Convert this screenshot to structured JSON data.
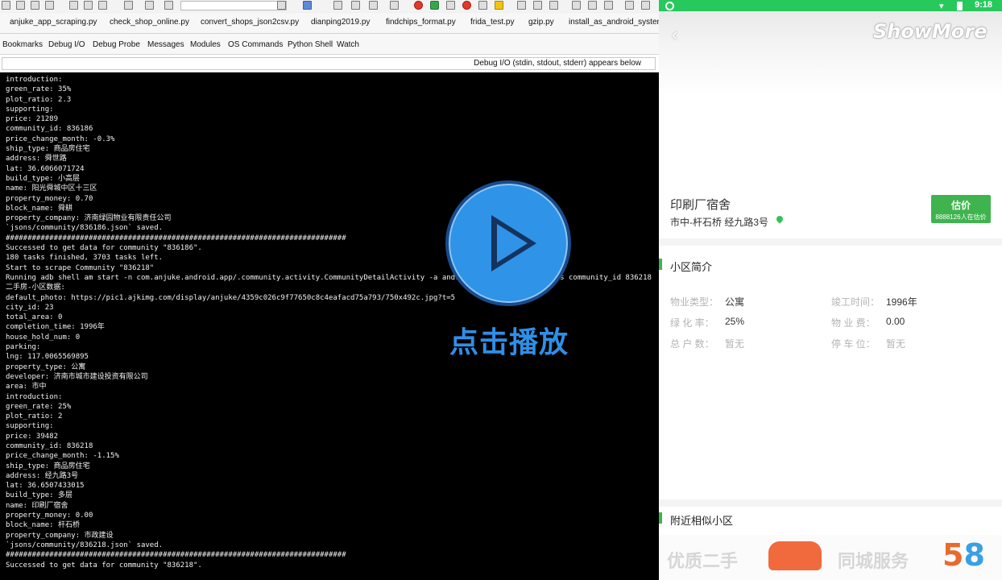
{
  "file_tabs": [
    "anjuke_app_scraping.py",
    "check_shop_online.py",
    "convert_shops_json2csv.py",
    "dianping2019.py",
    "findchips_format.py",
    "frida_test.py",
    "gzip.py",
    "install_as_android_system"
  ],
  "tool_tabs": [
    "Bookmarks",
    "Debug I/O",
    "Debug Probe",
    "Messages",
    "Modules",
    "OS Commands",
    "Python Shell",
    "Watch"
  ],
  "debug_io": {
    "status": "Debug I/O (stdin, stdout, stderr) appears below"
  },
  "console": {
    "lines": [
      "introduction:",
      "green_rate: 35%",
      "plot_ratio: 2.3",
      "supporting:",
      "price: 21289",
      "community_id: 836186",
      "price_change_month: -0.3%",
      "ship_type: 商品房住宅",
      "address: 舜世路",
      "lat: 36.6066071724",
      "build_type: 小高层",
      "name: 阳光舜城中区十三区",
      "property_money: 0.70",
      "block_name: 舜耕",
      "property_company: 济南绿园物业有限责任公司",
      "`jsons/community/836186.json` saved.",
      "##############################################################################",
      "Successed to get data for community \"836186\".",
      "180 tasks finished, 3703 tasks left.",
      "Start to scrape Community \"836218\"",
      "Running adb shell am start -n com.anjuke.android.app/.community.activity.CommunityDetailActivity -a andro                    -es community_id 836218",
      "二手房-小区数据:",
      "default_photo: https://pic1.ajkimg.com/display/anjuke/4359c026c9f77650c8c4eafacd75a793/750x492c.jpg?t=5",
      "city_id: 23",
      "total_area: 0",
      "completion_time: 1996年",
      "house_hold_num: 0",
      "parking:",
      "lng: 117.0065569895",
      "property_type: 公寓",
      "developer: 济南市城市建设投资有限公司",
      "area: 市中",
      "introduction:",
      "green_rate: 25%",
      "plot_ratio: 2",
      "supporting:",
      "price: 39482",
      "community_id: 836218",
      "price_change_month: -1.15%",
      "ship_type: 商品房住宅",
      "address: 经九路3号",
      "lat: 36.6507433015",
      "build_type: 多层",
      "name: 印刷厂宿舍",
      "property_money: 0.00",
      "block_name: 杆石桥",
      "property_company: 市政建设",
      "`jsons/community/836218.json` saved.",
      "##############################################################################",
      "Successed to get data for community \"836218\"."
    ]
  },
  "overlay": {
    "play_label": "点击播放"
  },
  "phone": {
    "status_time": "9:18",
    "watermark": "ShowMore",
    "back_icon": "‹",
    "community_name": "印刷厂宿舍",
    "community_address": "市中-杆石桥 经九路3号",
    "estimate_title": "估价",
    "estimate_sub": "8888126人在估价",
    "section_intro": "小区简介",
    "info": {
      "property_type_label": "物业类型：",
      "property_type_value": "公寓",
      "completion_label": "竣工时间：",
      "completion_value": "1996年",
      "green_label": "绿 化 率：",
      "green_value": "25%",
      "fee_label": "物 业 费：",
      "fee_value": "0.00",
      "households_label": "总 户 数：",
      "households_value": "暂无",
      "parking_label": "停 车 位：",
      "parking_value": "暂无"
    },
    "section_nearby": "附近相似小区",
    "banner_left": "优质二手",
    "banner_right": "同城服务",
    "banner_logo_a": "5",
    "banner_logo_b": "8"
  },
  "colors": {
    "accent_green": "#3fb44e",
    "status_green": "#27c95c",
    "play_blue": "#2f93e8",
    "console_bg": "#000000"
  }
}
